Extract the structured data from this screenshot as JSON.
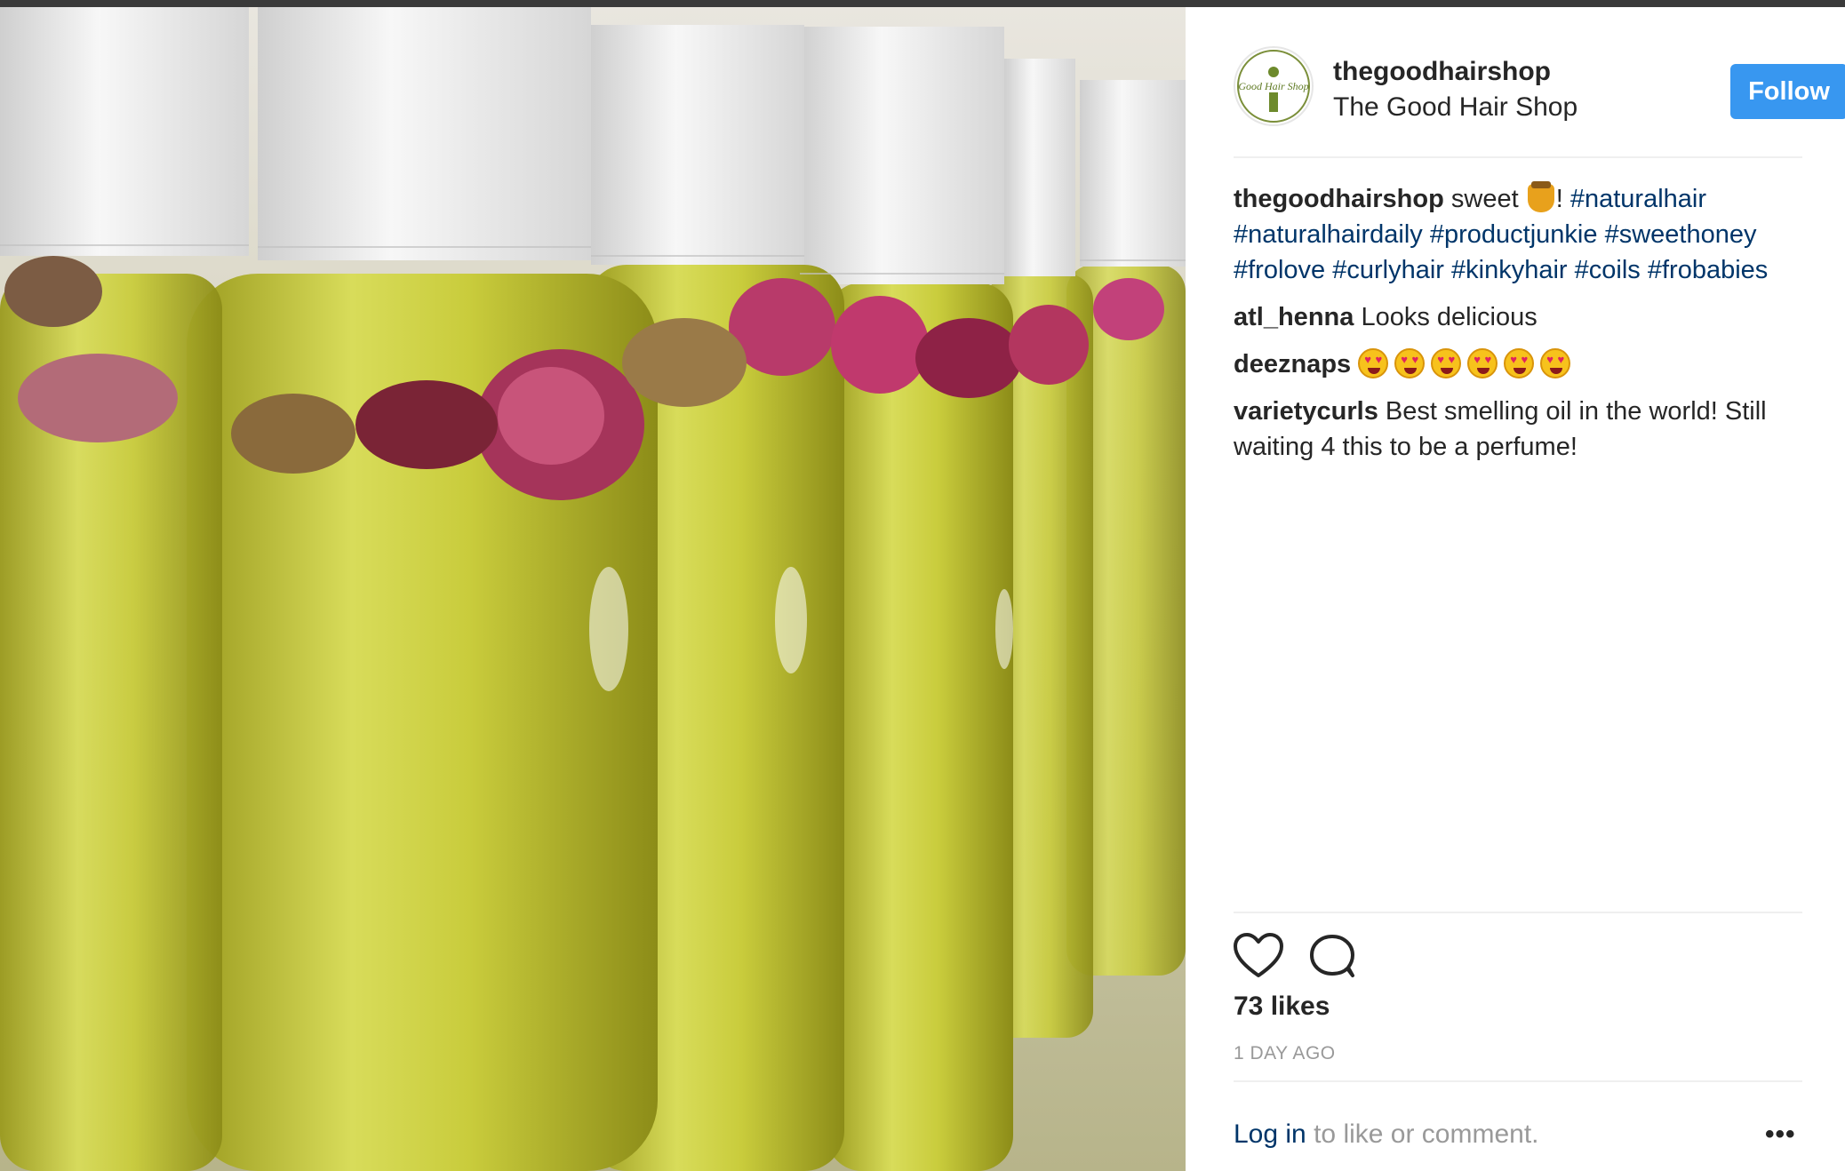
{
  "post": {
    "image_alt": "Bottles of yellow oil with rosebuds",
    "author": {
      "username": "thegoodhairshop",
      "full_name": "The Good Hair Shop",
      "avatar_logo": "Good Hair Shop"
    },
    "follow_label": "Follow",
    "caption": {
      "username": "thegoodhairshop",
      "text_before": "sweet",
      "emoji": "honey-pot-emoji",
      "text_after": "!",
      "hashtags": [
        "#naturalhair",
        "#naturalhairdaily",
        "#productjunkie",
        "#sweethoney",
        "#frolove",
        "#curlyhair",
        "#kinkyhair",
        "#coils",
        "#frobabies"
      ]
    },
    "comments": [
      {
        "username": "atl_henna",
        "text": "Looks delicious"
      },
      {
        "username": "deeznaps",
        "emojis": [
          "heart-eyes-emoji",
          "heart-eyes-emoji",
          "heart-eyes-emoji",
          "heart-eyes-emoji",
          "heart-eyes-emoji",
          "heart-eyes-emoji"
        ]
      },
      {
        "username": "varietycurls",
        "text": "Best smelling oil in the world! Still waiting 4 this to be a perfume!"
      }
    ],
    "likes": "73 likes",
    "date": "1 DAY AGO",
    "login_link": "Log in",
    "login_text": " to like or comment.",
    "more_label": "•••"
  },
  "colors": {
    "accent": "#3897f0",
    "link": "#003569",
    "muted": "#999999"
  },
  "icons": [
    "heart-icon",
    "comment-icon",
    "more-options-icon"
  ]
}
